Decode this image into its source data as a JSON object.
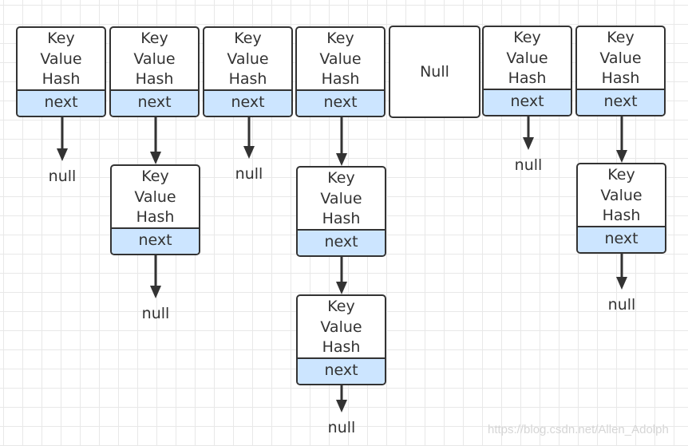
{
  "node": {
    "key": "Key",
    "value": "Value",
    "hash": "Hash",
    "next": "next"
  },
  "null_label": "null",
  "empty_bucket": "Null",
  "watermark": "https://blog.csdn.net/Allen_Adolph",
  "buckets": [
    {
      "chain_length": 1
    },
    {
      "chain_length": 2
    },
    {
      "chain_length": 1
    },
    {
      "chain_length": 3
    },
    {
      "chain_length": 0
    },
    {
      "chain_length": 1
    },
    {
      "chain_length": 2
    }
  ],
  "colors": {
    "next_fill": "#cce5ff",
    "stroke": "#333333"
  }
}
